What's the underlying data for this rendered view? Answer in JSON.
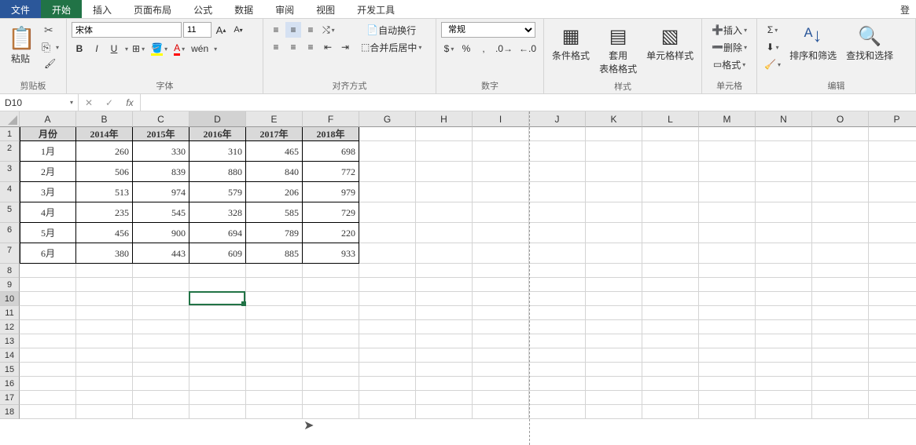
{
  "tabs": {
    "file": "文件",
    "home": "开始",
    "insert": "插入",
    "layout": "页面布局",
    "formula": "公式",
    "data": "数据",
    "review": "审阅",
    "view": "视图",
    "dev": "开发工具"
  },
  "login": "登",
  "ribbon": {
    "clipboard": {
      "label": "剪贴板",
      "paste": "粘贴"
    },
    "font": {
      "label": "字体",
      "name": "宋体",
      "size": "11",
      "bold": "B",
      "italic": "I",
      "underline": "U",
      "pinyin": "wén"
    },
    "align": {
      "label": "对齐方式",
      "wrap": "自动换行",
      "merge": "合并后居中"
    },
    "number": {
      "label": "数字",
      "format": "常规"
    },
    "styles": {
      "label": "样式",
      "cond": "条件格式",
      "table": "套用\n表格格式",
      "cell": "单元格样式"
    },
    "cells": {
      "label": "单元格",
      "insert": "插入",
      "delete": "删除",
      "format": "格式"
    },
    "editing": {
      "label": "编辑",
      "sort": "排序和筛选",
      "find": "查找和选择"
    }
  },
  "formula_bar": {
    "name_box": "D10",
    "fx": "fx"
  },
  "columns": [
    "A",
    "B",
    "C",
    "D",
    "E",
    "F",
    "G",
    "H",
    "I",
    "J",
    "K",
    "L",
    "M",
    "N",
    "O",
    "P"
  ],
  "active": {
    "row": 10,
    "col": "D"
  },
  "table": {
    "headers": [
      "月份",
      "2014年",
      "2015年",
      "2016年",
      "2017年",
      "2018年"
    ],
    "rows": [
      [
        "1月",
        "260",
        "330",
        "310",
        "465",
        "698"
      ],
      [
        "2月",
        "506",
        "839",
        "880",
        "840",
        "772"
      ],
      [
        "3月",
        "513",
        "974",
        "579",
        "206",
        "979"
      ],
      [
        "4月",
        "235",
        "545",
        "328",
        "585",
        "729"
      ],
      [
        "5月",
        "456",
        "900",
        "694",
        "789",
        "220"
      ],
      [
        "6月",
        "380",
        "443",
        "609",
        "885",
        "933"
      ]
    ]
  },
  "total_rows": 18
}
